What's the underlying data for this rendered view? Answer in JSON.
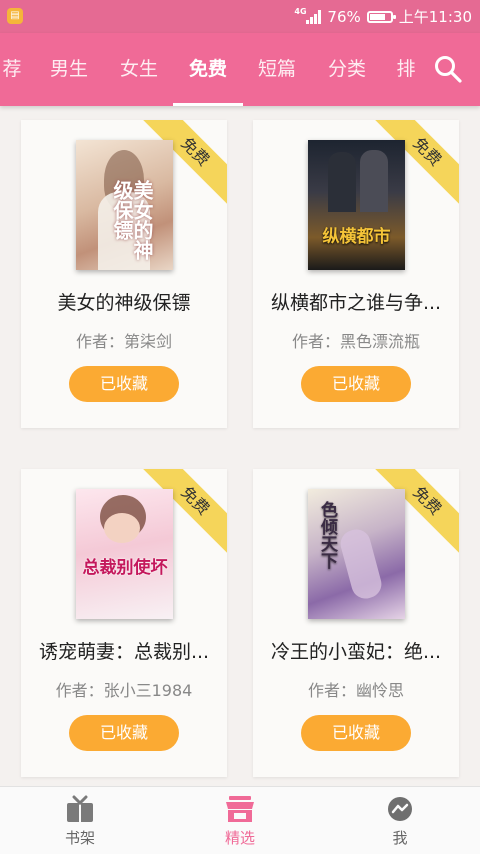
{
  "status_bar": {
    "network": "4G",
    "battery_percent": "76%",
    "battery_level": 0.76,
    "time": "上午11:30"
  },
  "tabs": [
    {
      "label": "荐",
      "active": false
    },
    {
      "label": "男生",
      "active": false
    },
    {
      "label": "女生",
      "active": false
    },
    {
      "label": "免费",
      "active": true
    },
    {
      "label": "短篇",
      "active": false
    },
    {
      "label": "分类",
      "active": false
    },
    {
      "label": "排",
      "active": false
    }
  ],
  "books": [
    {
      "badge": "免费",
      "title": "美女的神级保镖",
      "author": "作者：第柒剑",
      "button": "已收藏",
      "cover_title": "美女的神级保镖"
    },
    {
      "badge": "免费",
      "title": "纵横都市之谁与争...",
      "author": "作者：黑色漂流瓶",
      "button": "已收藏",
      "cover_title": "纵横都市"
    },
    {
      "badge": "免费",
      "title": "诱宠萌妻：总裁别...",
      "author": "作者：张小三1984",
      "button": "已收藏",
      "cover_title": "总裁别使坏"
    },
    {
      "badge": "免费",
      "title": "冷王的小蛮妃：绝...",
      "author": "作者：幽怜思",
      "button": "已收藏",
      "cover_title": "色倾天下"
    }
  ],
  "bottom_nav": [
    {
      "label": "书架",
      "active": false
    },
    {
      "label": "精选",
      "active": true
    },
    {
      "label": "我",
      "active": false
    }
  ],
  "colors": {
    "primary": "#f06a97",
    "status_bar": "#e56a93",
    "button": "#fbaa33",
    "ribbon": "#f5d55a"
  }
}
